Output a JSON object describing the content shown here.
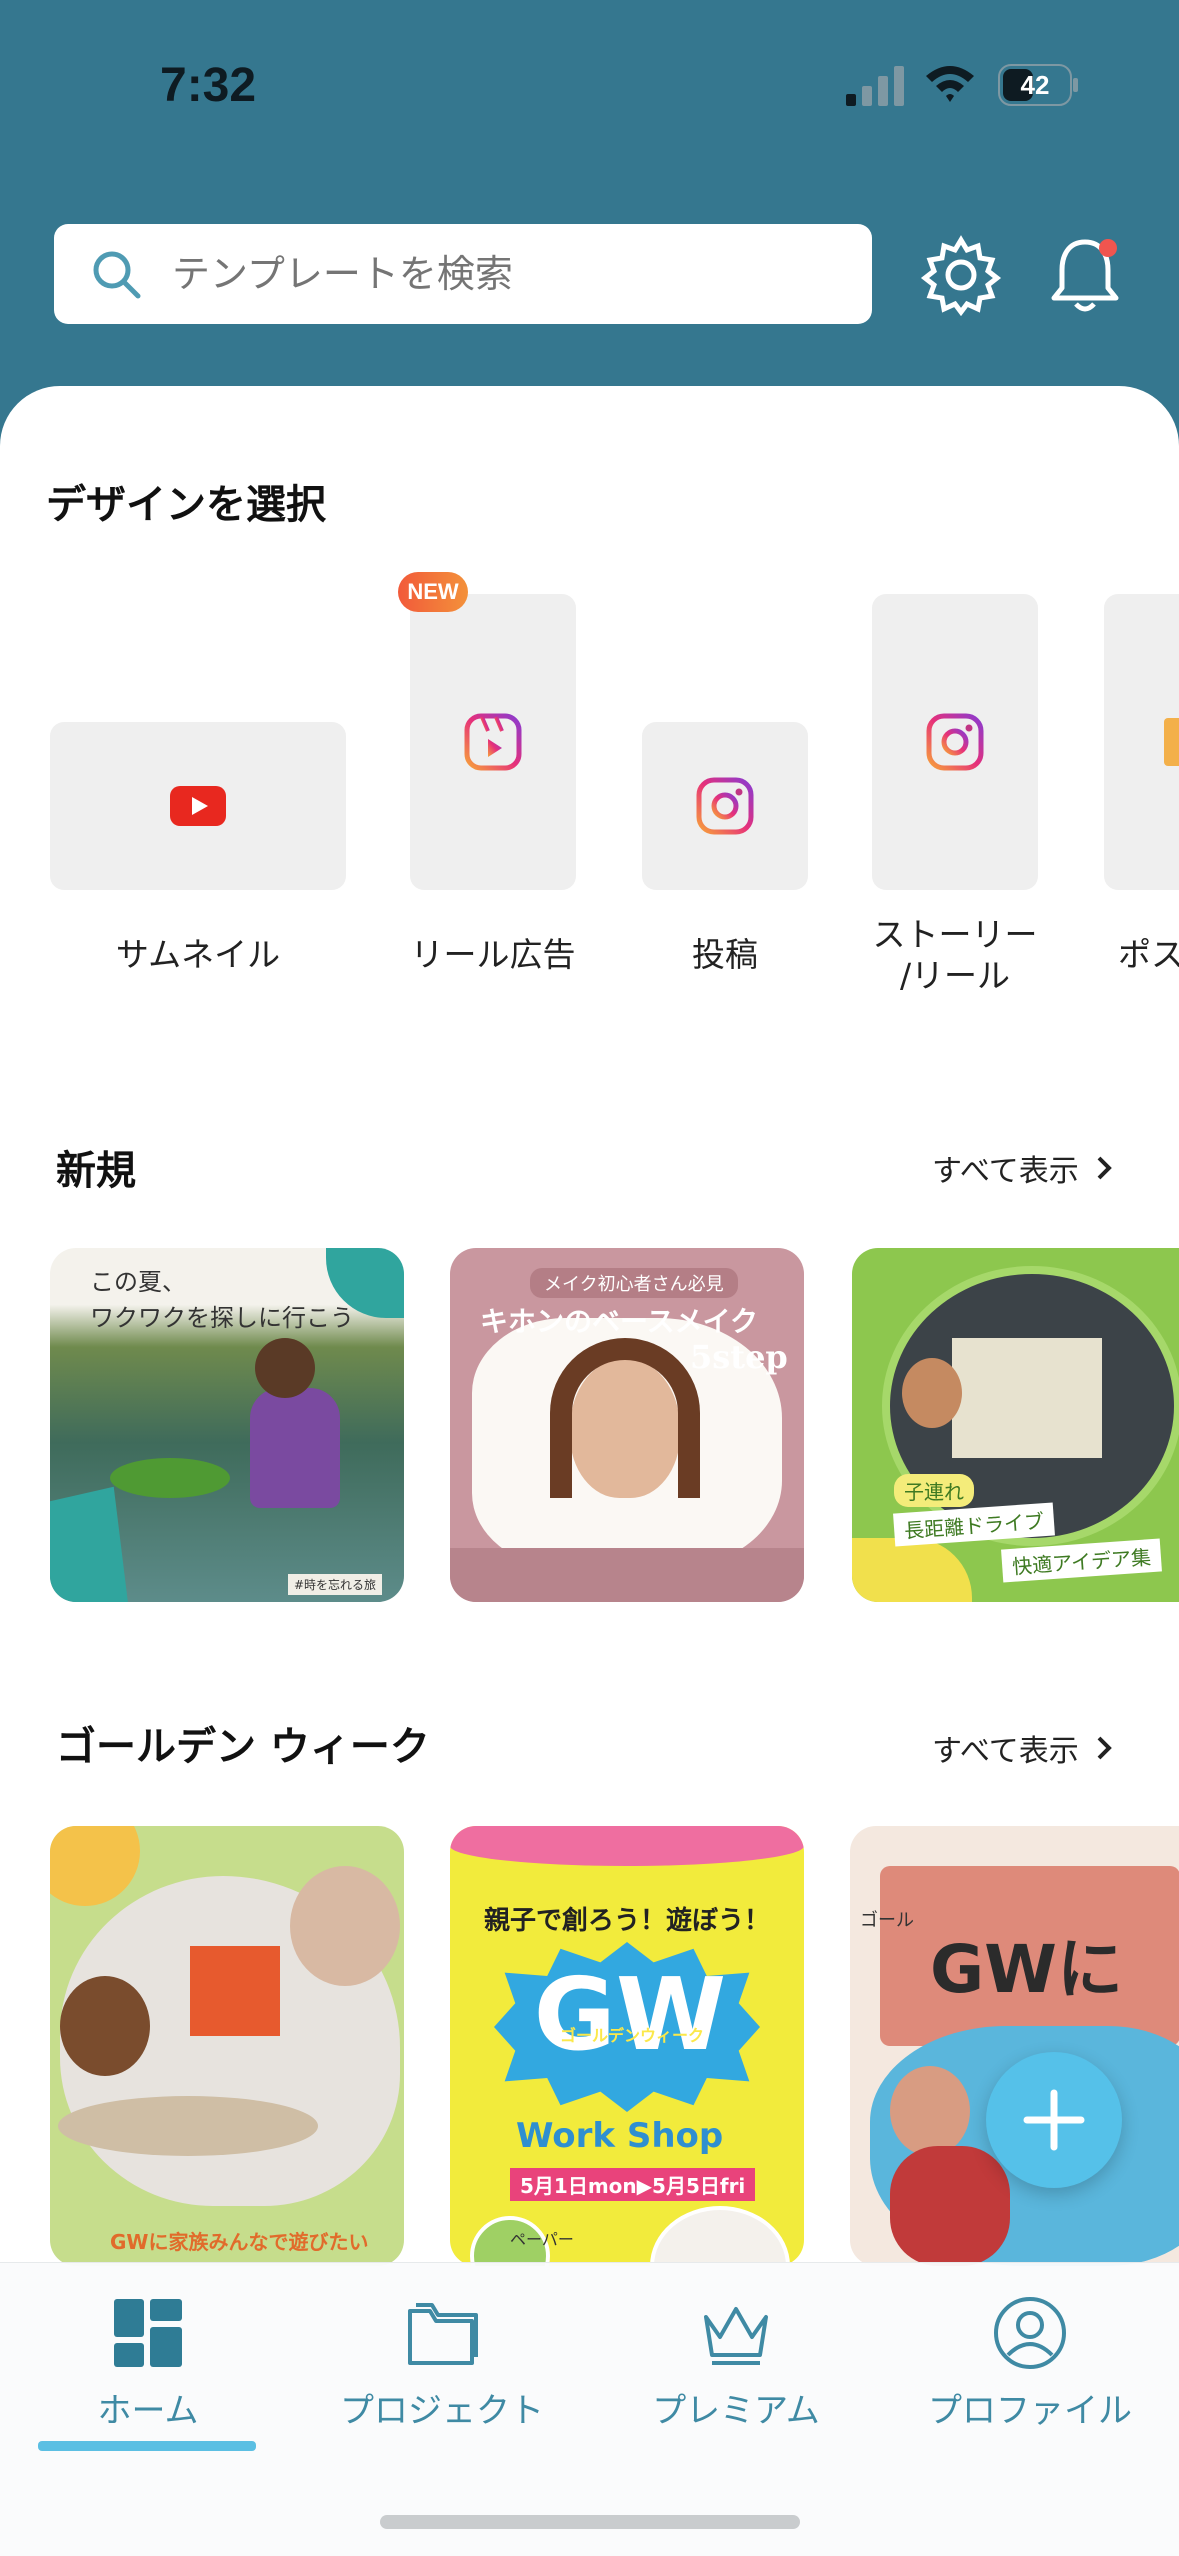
{
  "status": {
    "time": "7:32",
    "battery": "42"
  },
  "search": {
    "placeholder": "テンプレートを検索"
  },
  "design": {
    "title": "デザインを選択",
    "new_badge": "NEW",
    "items": [
      {
        "label": "サムネイル",
        "icon": "youtube-icon"
      },
      {
        "label": "リール広告",
        "icon": "reels-icon"
      },
      {
        "label": "投稿",
        "icon": "instagram-icon"
      },
      {
        "label": "ストーリー\n/リール",
        "icon": "instagram-icon"
      },
      {
        "label": "ポス",
        "icon": "poster-icon"
      }
    ]
  },
  "new_section": {
    "title": "新規",
    "see_all": "すべて表示",
    "cards": [
      {
        "line1": "この夏、",
        "line2": "ワクワクを探しに行こう",
        "tag": "#時を忘れる旅"
      },
      {
        "top": "メイク初心者さん必見",
        "title": "キホンのベースメイク",
        "step": "5step"
      },
      {
        "tag1": "子連れ",
        "tag2": "長距離ドライブ",
        "tag3": "快適アイデア集"
      }
    ]
  },
  "gw_section": {
    "title": "ゴールデン ウィーク",
    "see_all": "すべて表示",
    "cards": [
      {
        "caption": "GWに家族みんなで遊びたい"
      },
      {
        "headline": "親子で創ろう！遊ぼう！",
        "big": "GW",
        "sub": "ゴールデンウィーク",
        "ws": "Work Shop",
        "dates": "5月1日mon▶5月5日fri",
        "paper": "ペーパー"
      },
      {
        "small": "ゴール",
        "big": "GWに"
      }
    ]
  },
  "tabs": [
    {
      "label": "ホーム",
      "icon": "home-icon"
    },
    {
      "label": "プロジェクト",
      "icon": "folder-icon"
    },
    {
      "label": "プレミアム",
      "icon": "crown-icon"
    },
    {
      "label": "プロファイル",
      "icon": "profile-icon"
    }
  ],
  "colors": {
    "header": "#35778f",
    "accent": "#5bbfe3",
    "tab": "#3f8aa4"
  }
}
